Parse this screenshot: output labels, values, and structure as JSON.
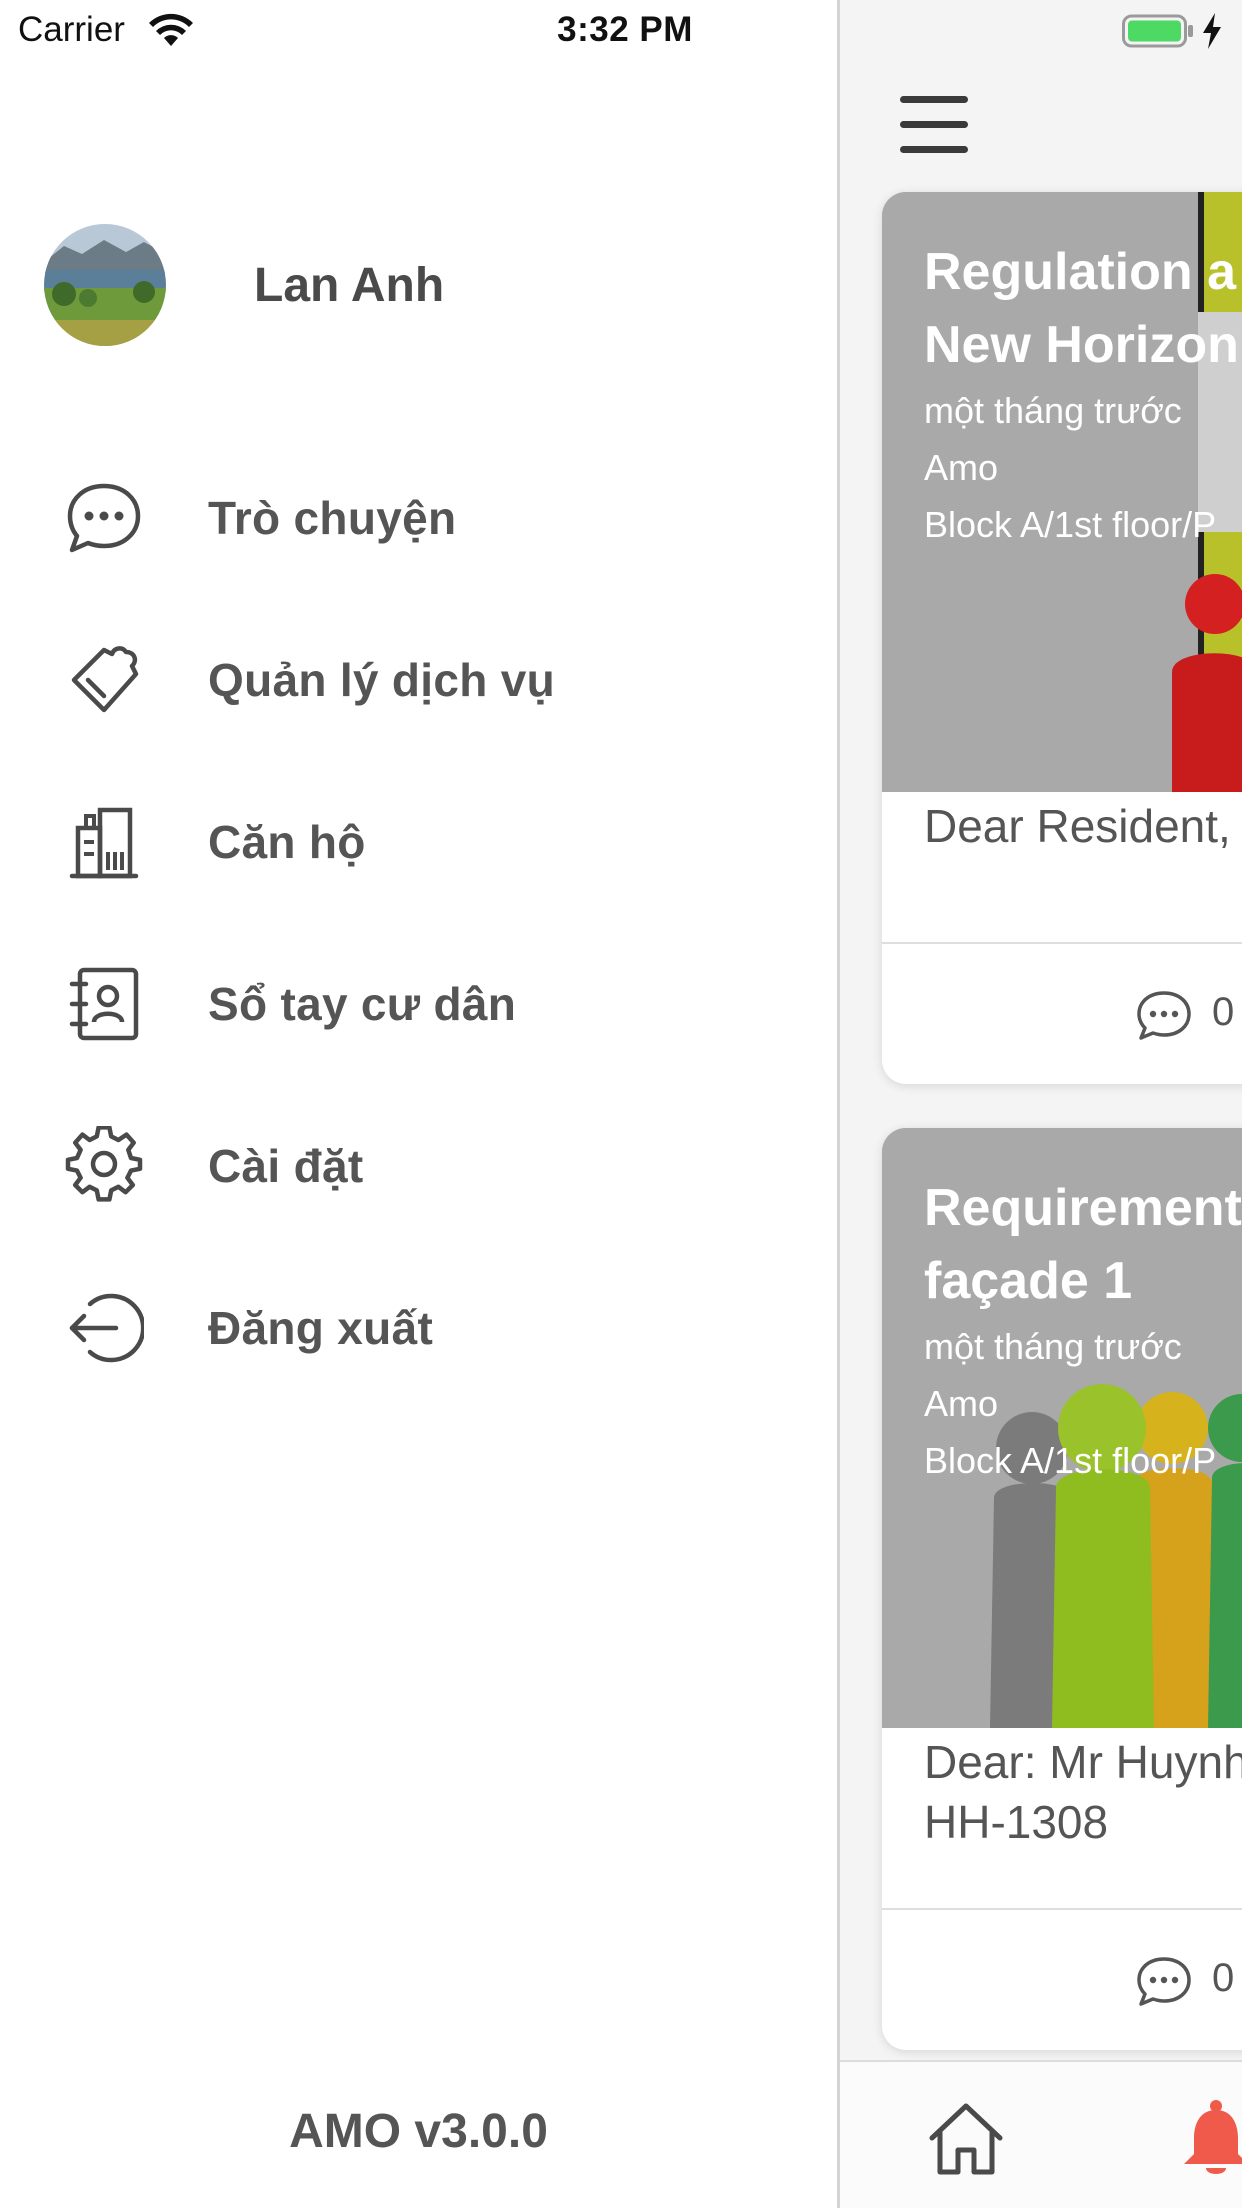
{
  "status_bar": {
    "carrier": "Carrier",
    "time": "3:32 PM",
    "battery_color": "#4cd964"
  },
  "drawer": {
    "profile": {
      "name": "Lan Anh"
    },
    "menu": [
      {
        "label": "Trò chuyện",
        "icon": "chat-icon"
      },
      {
        "label": "Quản lý dịch vụ",
        "icon": "service-tag-icon"
      },
      {
        "label": "Căn hộ",
        "icon": "building-icon"
      },
      {
        "label": "Sổ tay cư dân",
        "icon": "contacts-book-icon"
      },
      {
        "label": "Cài đặt",
        "icon": "gear-icon"
      },
      {
        "label": "Đăng xuất",
        "icon": "logout-icon"
      }
    ],
    "version": "AMO v3.0.0"
  },
  "content": {
    "cards": [
      {
        "title_line1": "Regulation a",
        "title_line2": "New Horizon",
        "time_ago": "một tháng trước",
        "author": "Amo",
        "location": "Block A/1st floor/P",
        "body_line1": "Dear Resident,",
        "body_line2": "",
        "comment_count": "0"
      },
      {
        "title_line1": "Requirement",
        "title_line2": "façade 1",
        "time_ago": "một tháng trước",
        "author": "Amo",
        "location": "Block A/1st floor/P",
        "body_line1": "Dear: Mr Huynh",
        "body_line2": "HH-1308",
        "comment_count": "0"
      }
    ],
    "bottom_nav": [
      {
        "icon": "home-icon"
      },
      {
        "icon": "bell-icon",
        "color": "#f05a4a"
      }
    ]
  }
}
